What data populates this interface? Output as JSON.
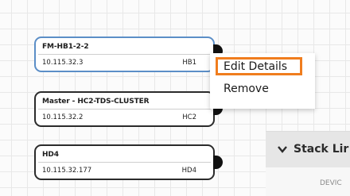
{
  "nodes": [
    {
      "title": "FM-HB1-2-2",
      "ip": "10.115.32.3",
      "tag": "HB1"
    },
    {
      "title": "Master - HC2-TDS-CLUSTER",
      "ip": "10.115.32.2",
      "tag": "HC2"
    },
    {
      "title": "HD4",
      "ip": "10.115.32.177",
      "tag": "HD4"
    }
  ],
  "context_menu": {
    "items": [
      {
        "label": "Edit Details"
      },
      {
        "label": "Remove"
      }
    ],
    "highlight_color": "#f07d1e"
  },
  "stack_panel": {
    "title": "Stack Lir",
    "column_header": "DEVIC",
    "chevron_icon": "chevron-down-icon"
  },
  "colors": {
    "selected_border": "#5b8ec7",
    "node_border": "#2b2b2b"
  }
}
